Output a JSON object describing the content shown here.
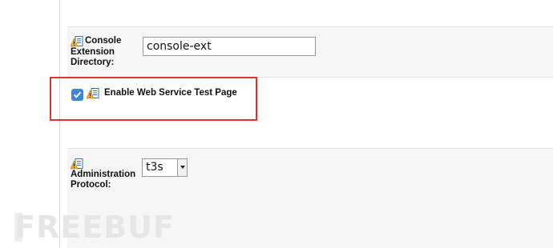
{
  "console_extension": {
    "label": "Console Extension Directory:",
    "value": "console-ext"
  },
  "web_service_test": {
    "label": "Enable Web Service Test Page",
    "checked": true
  },
  "administration_protocol": {
    "label": "Administration Protocol:",
    "selected": "t3s"
  },
  "watermark": {
    "text": "FREEBUF"
  },
  "colors": {
    "highlight": "#e53030",
    "checkbox": "#3b86d8",
    "section_bg": "#f6f6f6"
  },
  "icons": {
    "field_info": "warning-doc-icon"
  }
}
